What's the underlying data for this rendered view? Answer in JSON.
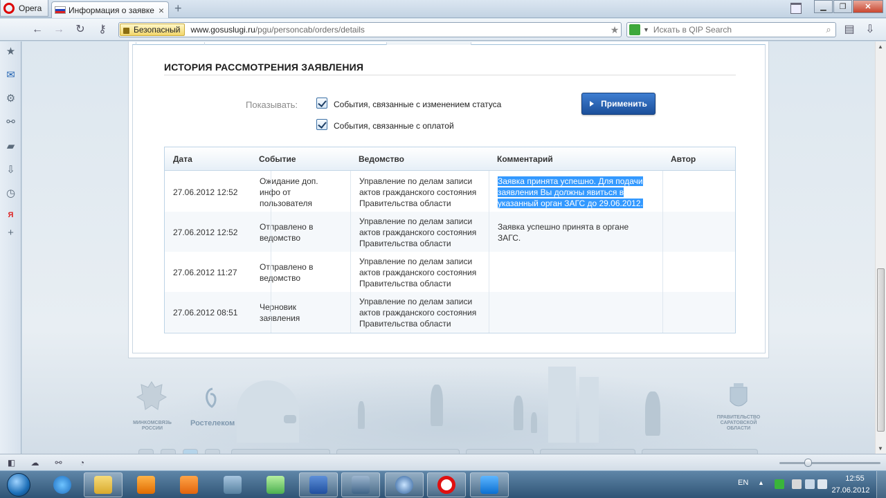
{
  "browser": {
    "menu_label": "Opera",
    "tab_title": "Информация о заявке",
    "secure_label": "Безопасный",
    "url_domain": "www.gosuslugi.ru",
    "url_path": "/pgu/personcab/orders/details",
    "search_placeholder": "Искать в QIP Search"
  },
  "page": {
    "section_title": "ИСТОРИЯ РАССМОТРЕНИЯ ЗАЯВЛЕНИЯ",
    "show_label": "Показывать:",
    "filters": [
      {
        "label": "События, связанные с изменением статуса",
        "checked": true
      },
      {
        "label": "События, связанные с оплатой",
        "checked": true
      }
    ],
    "apply_label": "Применить",
    "table": {
      "headers": [
        "Дата",
        "Событие",
        "Ведомство",
        "Комментарий",
        "Автор"
      ],
      "rows": [
        {
          "date": "27.06.2012 12:52",
          "event": [
            "Ожидание доп.",
            "инфо от",
            "пользователя"
          ],
          "agency": [
            "Управление по делам записи",
            "актов гражданского состояния",
            "Правительства области"
          ],
          "comment": [
            "Заявка принята успешно. Для подачи",
            "заявления Вы должны явиться в",
            "указанный орган ЗАГС до 29.06.2012."
          ],
          "author": ""
        },
        {
          "date": "27.06.2012 12:52",
          "event": [
            "Отправлено в",
            "ведомство"
          ],
          "agency": [
            "Управление по делам записи",
            "актов гражданского состояния",
            "Правительства области"
          ],
          "comment": [
            "Заявка успешно принята в органе",
            "ЗАГС."
          ],
          "author": ""
        },
        {
          "date": "27.06.2012 11:27",
          "event": [
            "Отправлено в",
            "ведомство"
          ],
          "agency": [
            "Управление по делам записи",
            "актов гражданского состояния",
            "Правительства области"
          ],
          "comment": [],
          "author": ""
        },
        {
          "date": "27.06.2012 08:51",
          "event": [
            "Черновик",
            "заявления"
          ],
          "agency": [
            "Управление по делам записи",
            "актов гражданского состояния",
            "Правительства области"
          ],
          "comment": [],
          "author": ""
        }
      ]
    },
    "footer": {
      "minsvyaz": [
        "МИНКОМСВЯЗЬ",
        "РОССИИ"
      ],
      "rostelecom": "Ростелеком",
      "saratov": [
        "ПРАВИТЕЛЬСТВО",
        "САРАТОВСКОЙ",
        "ОБЛАСТИ"
      ]
    }
  },
  "taskbar": {
    "lang": "EN",
    "time": "12:55",
    "date": "27.06.2012"
  },
  "colors": {
    "accent": "#1b4f9a",
    "selection": "#3399ff",
    "opera_red": "#dd0000"
  }
}
